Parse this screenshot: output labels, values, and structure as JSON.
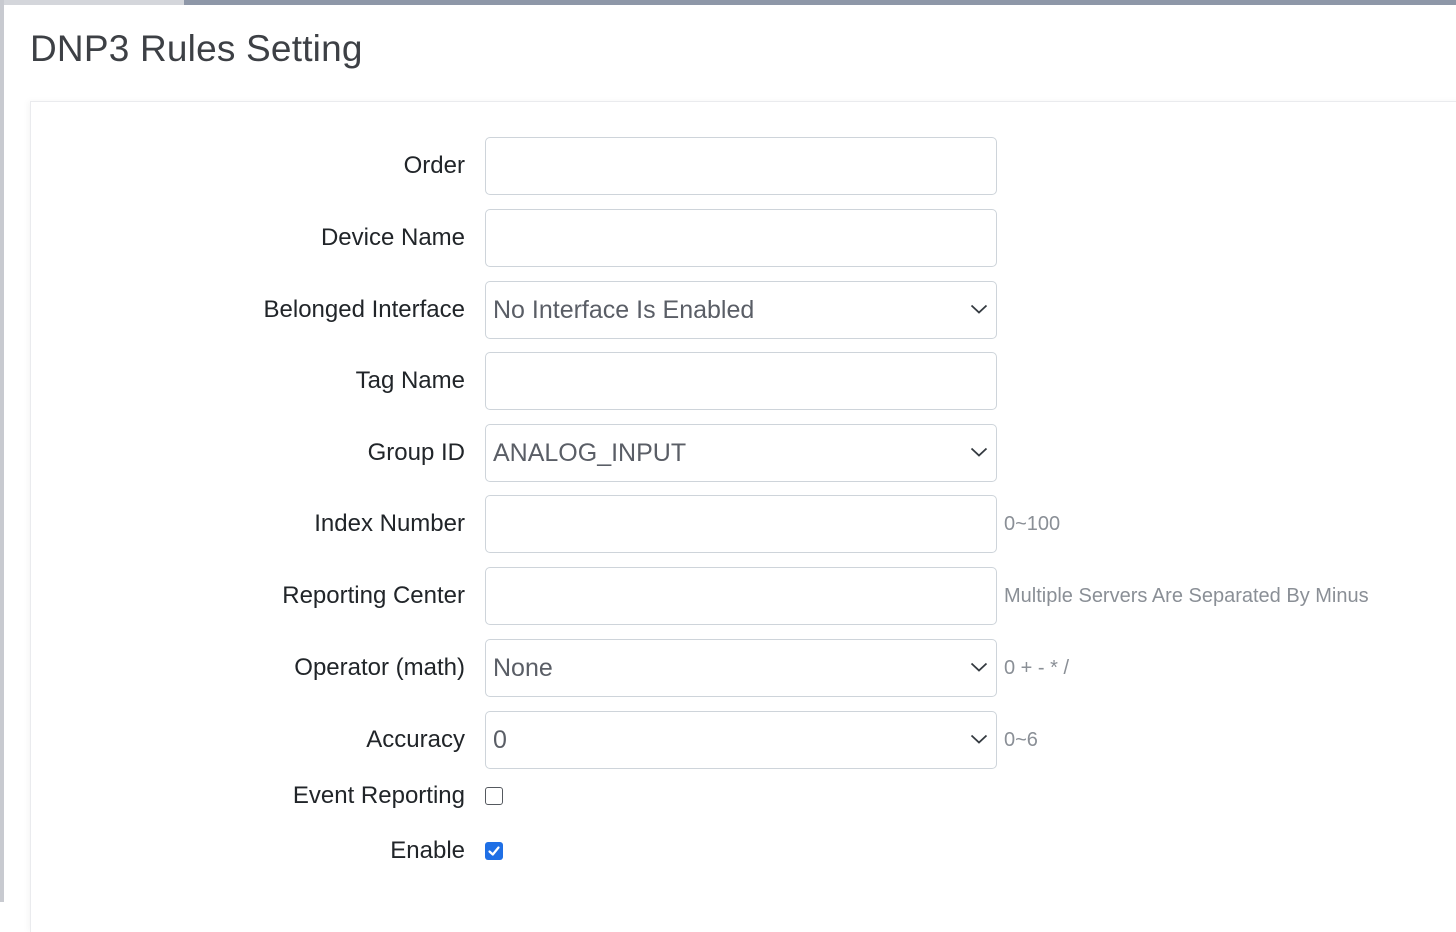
{
  "page": {
    "title": "DNP3 Rules Setting"
  },
  "form": {
    "order": {
      "label": "Order",
      "value": ""
    },
    "device_name": {
      "label": "Device Name",
      "value": ""
    },
    "belonged_interface": {
      "label": "Belonged Interface",
      "selected": "No Interface Is Enabled"
    },
    "tag_name": {
      "label": "Tag Name",
      "value": ""
    },
    "group_id": {
      "label": "Group ID",
      "selected": "ANALOG_INPUT"
    },
    "index_number": {
      "label": "Index Number",
      "value": "",
      "hint": "0~100"
    },
    "reporting_center": {
      "label": "Reporting Center",
      "value": "",
      "hint": "Multiple Servers Are Separated By Minus"
    },
    "operator": {
      "label": "Operator (math)",
      "selected": "None",
      "hint": "0 + - * /"
    },
    "accuracy": {
      "label": "Accuracy",
      "selected": "0",
      "hint": "0~6"
    },
    "event_reporting": {
      "label": "Event Reporting",
      "checked": false
    },
    "enable": {
      "label": "Enable",
      "checked": true
    }
  },
  "colors": {
    "accent": "#1f6fe5",
    "hint": "#8a8f96",
    "border": "#ced4da"
  },
  "icons": {
    "select_arrow": "chevron-down-icon",
    "check": "checkmark-icon"
  }
}
